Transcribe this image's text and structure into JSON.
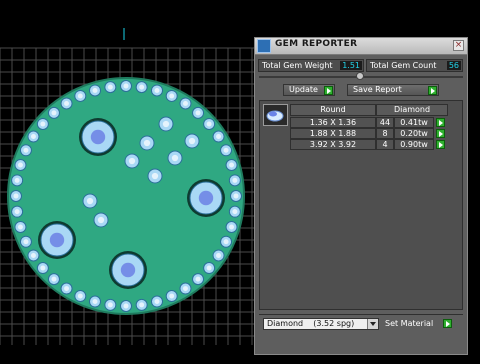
{
  "panel": {
    "title": "GEM REPORTER",
    "close_symbol": "×",
    "total_weight_label": "Total Gem Weight",
    "total_weight_value": "1.51",
    "total_count_label": "Total Gem Count",
    "total_count_value": "56",
    "update_label": "Update",
    "save_report_label": "Save Report",
    "table": {
      "headers": [
        "Round",
        "Diamond"
      ],
      "rows": [
        {
          "size": "1.36 X 1.36",
          "count": "44",
          "weight": "0.41tw"
        },
        {
          "size": "1.88 X 1.88",
          "count": "8",
          "weight": "0.20tw"
        },
        {
          "size": "3.92 X 3.92",
          "count": "4",
          "weight": "0.90tw"
        }
      ]
    },
    "material_select_value": "Diamond    (3.52 spg)",
    "set_material_label": "Set Material"
  },
  "colors": {
    "disc": "#2fa882",
    "disc_edge": "#1f7a5e",
    "grid": "#4a4a4a",
    "gem": "#a9d8f5",
    "large_gem_ring": "#0e3b30",
    "value_text": "#22d3e8",
    "arrow_green": "#2fb02f"
  },
  "icons": {
    "app": "gem-reporter-icon",
    "close": "close-icon",
    "thumb": "diamond-thumbnail-icon",
    "arrow": "green-arrow-icon"
  }
}
